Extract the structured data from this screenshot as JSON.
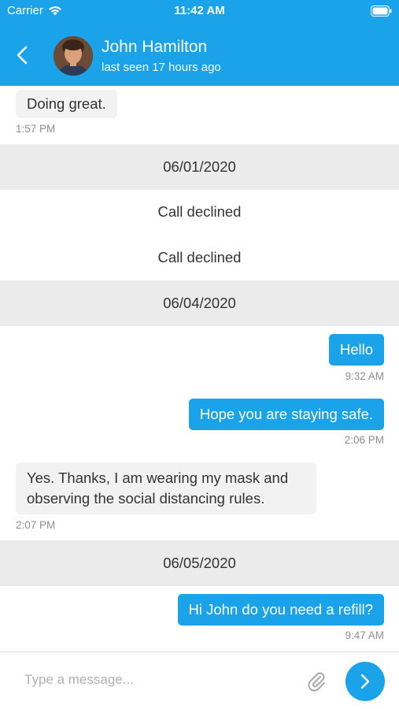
{
  "status_bar": {
    "carrier": "Carrier",
    "time": "11:42 AM"
  },
  "header": {
    "contact_name": "John Hamilton",
    "last_seen": "last seen 17 hours ago"
  },
  "messages": [
    {
      "type": "incoming",
      "text": "Doing great.",
      "time": "1:57 PM"
    },
    {
      "type": "date",
      "text": "06/01/2020"
    },
    {
      "type": "system",
      "text": "Call declined"
    },
    {
      "type": "system",
      "text": "Call declined"
    },
    {
      "type": "date",
      "text": "06/04/2020"
    },
    {
      "type": "outgoing",
      "text": "Hello",
      "time": "9:32 AM"
    },
    {
      "type": "outgoing",
      "text": "Hope you are staying safe.",
      "time": "2:06 PM"
    },
    {
      "type": "incoming",
      "lines": [
        "Yes. Thanks, I am wearing my mask and",
        "observing the social distancing rules."
      ],
      "time": "2:07 PM"
    },
    {
      "type": "date",
      "text": "06/05/2020"
    },
    {
      "type": "outgoing",
      "text": "Hi John do you need a refill?",
      "time": "9:47 AM"
    }
  ],
  "composer": {
    "placeholder": "Type a message..."
  },
  "colors": {
    "accent": "#1aa3e8",
    "incoming_bubble": "#f2f2f2",
    "date_band": "#ebebeb"
  },
  "icons": {
    "back": "chevron-left-icon",
    "wifi": "wifi-icon",
    "battery": "battery-icon",
    "attach": "paperclip-icon",
    "send": "chevron-right-icon"
  }
}
